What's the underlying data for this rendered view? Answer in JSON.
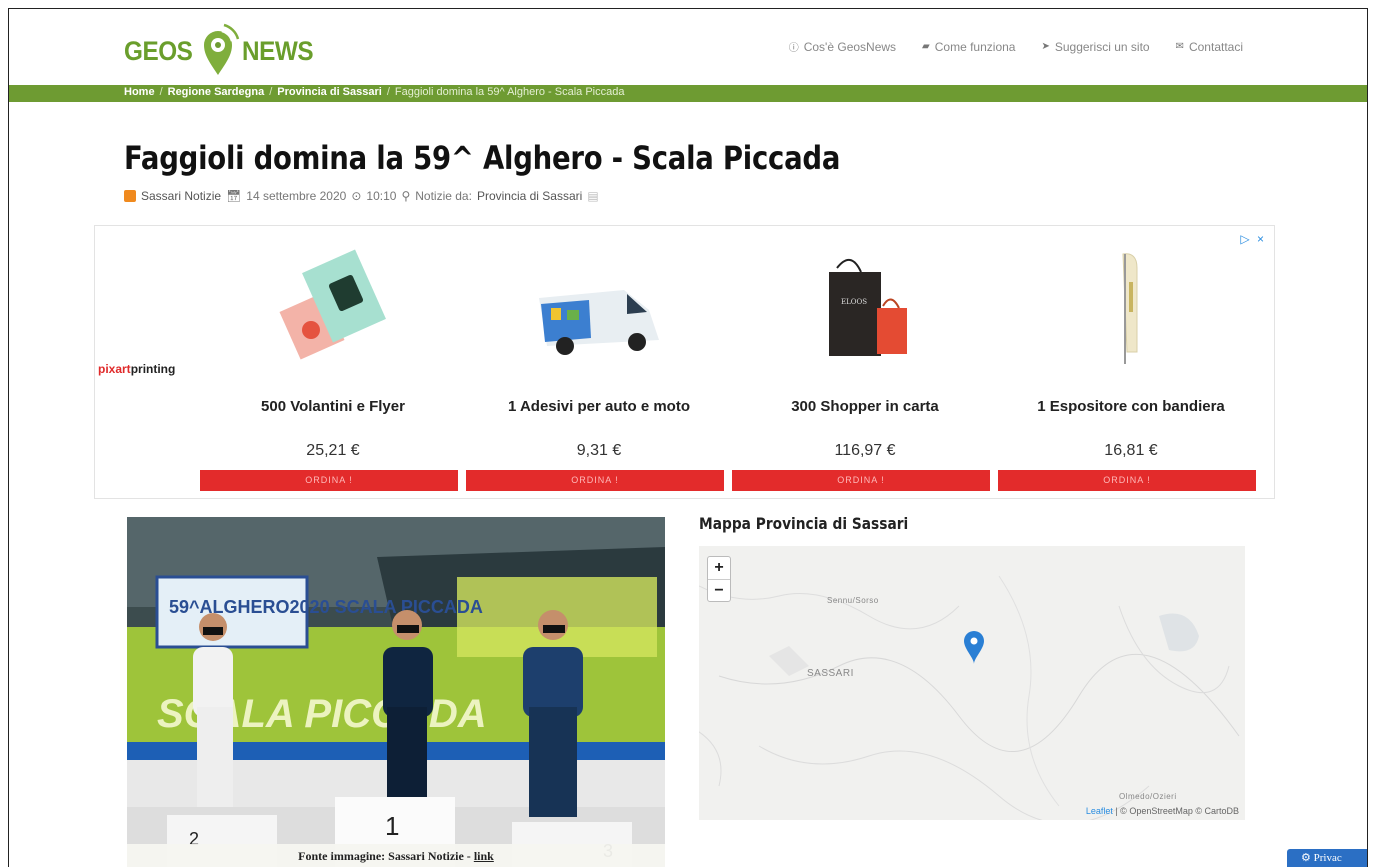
{
  "brand": {
    "logo_left": "GEOS",
    "logo_right": "NEWS",
    "green": "#6e9b32"
  },
  "nav": {
    "items": [
      {
        "icon": "info-circle-icon",
        "label": "Cos'è GeosNews"
      },
      {
        "icon": "book-icon",
        "label": "Come funziona"
      },
      {
        "icon": "send-icon",
        "label": "Suggerisci un sito"
      },
      {
        "icon": "envelope-icon",
        "label": "Contattaci"
      }
    ]
  },
  "breadcrumb": {
    "home": "Home",
    "region": "Regione Sardegna",
    "province": "Provincia di Sassari",
    "current": "Faggioli domina la 59^ Alghero - Scala Piccada",
    "separator": "/"
  },
  "article": {
    "title": "Faggioli domina la 59^ Alghero - Scala Piccada",
    "source": "Sassari Notizie",
    "date": "14 settembre 2020",
    "time": "10:10",
    "news_from_label": "Notizie da:",
    "news_from": "Provincia di Sassari"
  },
  "ad": {
    "brand_red": "pixart",
    "brand_dark": "printing",
    "close": "▷ ×",
    "products": [
      {
        "name": "500 Volantini e Flyer",
        "price": "25,21 €",
        "button": "ORDINA !"
      },
      {
        "name": "1 Adesivi per auto e moto",
        "price": "9,31 €",
        "button": "ORDINA !"
      },
      {
        "name": "300 Shopper in carta",
        "price": "116,97 €",
        "button": "ORDINA !"
      },
      {
        "name": "1 Espositore con bandiera",
        "price": "16,81 €",
        "button": "ORDINA !"
      }
    ]
  },
  "photo": {
    "caption_prefix": "Fonte immagine: Sassari Notizie - ",
    "caption_link": "link",
    "banner_text": "59^ALGHERO2020 SCALA PICCADA",
    "event_text": "SCALA PICCADA",
    "podium": [
      "2",
      "1",
      "3"
    ]
  },
  "map": {
    "title": "Mappa Provincia di Sassari",
    "zoom_in": "+",
    "zoom_out": "−",
    "labels": {
      "city": "SASSARI",
      "town": "Sennu/Sorso",
      "town2": "Olmedo/Ozieri"
    },
    "attribution_link": "Leaflet",
    "attribution_rest": " | © OpenStreetMap © CartoDB"
  },
  "privacy": {
    "label": "Privac"
  }
}
